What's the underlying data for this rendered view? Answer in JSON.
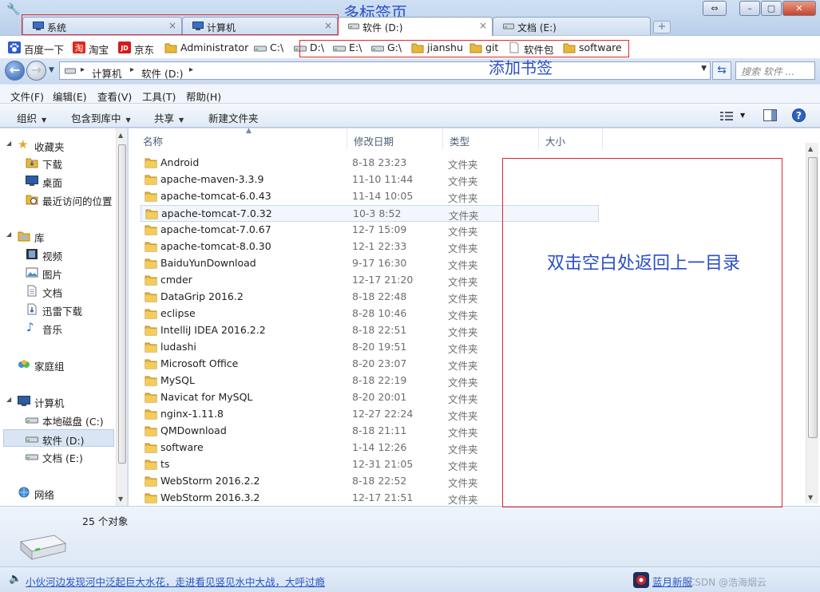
{
  "tabs": [
    {
      "label": "系统",
      "active": false
    },
    {
      "label": "计算机",
      "active": false
    },
    {
      "label": "软件 (D:)",
      "active": true
    },
    {
      "label": "文档 (E:)",
      "active": false
    }
  ],
  "annotations": {
    "tabs_note": "多标签页",
    "bookmarks_note": "添加书签",
    "blank_note": "双击空白处返回上一目录"
  },
  "bookmarks": [
    {
      "label": "百度一下",
      "icon": "paw-icon"
    },
    {
      "label": "淘宝",
      "icon": "taobao-icon"
    },
    {
      "label": "京东",
      "icon": "jd-icon"
    },
    {
      "label": "Administrator",
      "icon": "folder-icon"
    },
    {
      "label": "C:\\",
      "icon": "drive-icon"
    },
    {
      "label": "D:\\",
      "icon": "drive-icon"
    },
    {
      "label": "E:\\",
      "icon": "drive-icon"
    },
    {
      "label": "G:\\",
      "icon": "drive-icon"
    },
    {
      "label": "jianshu",
      "icon": "folder-icon"
    },
    {
      "label": "git",
      "icon": "folder-icon"
    },
    {
      "label": "软件包",
      "icon": "file-icon"
    },
    {
      "label": "software",
      "icon": "folder-icon"
    }
  ],
  "address": {
    "crumbs": [
      "计算机",
      "软件 (D:)"
    ],
    "search_placeholder": "搜索 软件 ..."
  },
  "menu": [
    "文件(F)",
    "编辑(E)",
    "查看(V)",
    "工具(T)",
    "帮助(H)"
  ],
  "toolbar": {
    "organize": "组织",
    "include_library": "包含到库中",
    "share": "共享",
    "new_folder": "新建文件夹"
  },
  "nav": {
    "favorites": "收藏夹",
    "downloads": "下载",
    "desktop": "桌面",
    "recent": "最近访问的位置",
    "libraries": "库",
    "videos": "视频",
    "pictures": "图片",
    "documents": "文档",
    "xunlei": "迅雷下载",
    "music": "音乐",
    "homegroup": "家庭组",
    "computer": "计算机",
    "local_c": "本地磁盘 (C:)",
    "soft_d": "软件 (D:)",
    "doc_e": "文档 (E:)",
    "network": "网络"
  },
  "columns": {
    "name": "名称",
    "date": "修改日期",
    "type": "类型",
    "size": "大小"
  },
  "files": [
    {
      "name": "Android",
      "date": "8-18 23:23",
      "type": "文件夹"
    },
    {
      "name": "apache-maven-3.3.9",
      "date": "11-10 11:44",
      "type": "文件夹"
    },
    {
      "name": "apache-tomcat-6.0.43",
      "date": "11-14 10:05",
      "type": "文件夹"
    },
    {
      "name": "apache-tomcat-7.0.32",
      "date": "10-3 8:52",
      "type": "文件夹"
    },
    {
      "name": "apache-tomcat-7.0.67",
      "date": "12-7 15:09",
      "type": "文件夹"
    },
    {
      "name": "apache-tomcat-8.0.30",
      "date": "12-1 22:33",
      "type": "文件夹"
    },
    {
      "name": "BaiduYunDownload",
      "date": "9-17 16:30",
      "type": "文件夹"
    },
    {
      "name": "cmder",
      "date": "12-17 21:20",
      "type": "文件夹"
    },
    {
      "name": "DataGrip 2016.2",
      "date": "8-18 22:48",
      "type": "文件夹"
    },
    {
      "name": "eclipse",
      "date": "8-28 10:46",
      "type": "文件夹"
    },
    {
      "name": "IntelliJ IDEA 2016.2.2",
      "date": "8-18 22:51",
      "type": "文件夹"
    },
    {
      "name": "ludashi",
      "date": "8-20 19:51",
      "type": "文件夹"
    },
    {
      "name": "Microsoft Office",
      "date": "8-20 23:07",
      "type": "文件夹"
    },
    {
      "name": "MySQL",
      "date": "8-18 22:19",
      "type": "文件夹"
    },
    {
      "name": "Navicat for MySQL",
      "date": "8-20 20:01",
      "type": "文件夹"
    },
    {
      "name": "nginx-1.11.8",
      "date": "12-27 22:24",
      "type": "文件夹"
    },
    {
      "name": "QMDownload",
      "date": "8-18 21:11",
      "type": "文件夹"
    },
    {
      "name": "software",
      "date": "1-14 12:26",
      "type": "文件夹"
    },
    {
      "name": "ts",
      "date": "12-31 21:05",
      "type": "文件夹"
    },
    {
      "name": "WebStorm 2016.2.2",
      "date": "8-18 22:52",
      "type": "文件夹"
    },
    {
      "name": "WebStorm 2016.3.2",
      "date": "12-17 21:51",
      "type": "文件夹"
    }
  ],
  "status": {
    "count": "25 个对象",
    "ticker": "小伙河边发现河中泛起巨大水花，走进看见竖见水中大战，大呼过瘾",
    "right_link": "蓝月新服",
    "watermark": "CSDN @浩海烟云"
  },
  "colors": {
    "annotation": "#2b4ec7",
    "highlight_box": "#e2262c",
    "link": "#2a57c4"
  }
}
